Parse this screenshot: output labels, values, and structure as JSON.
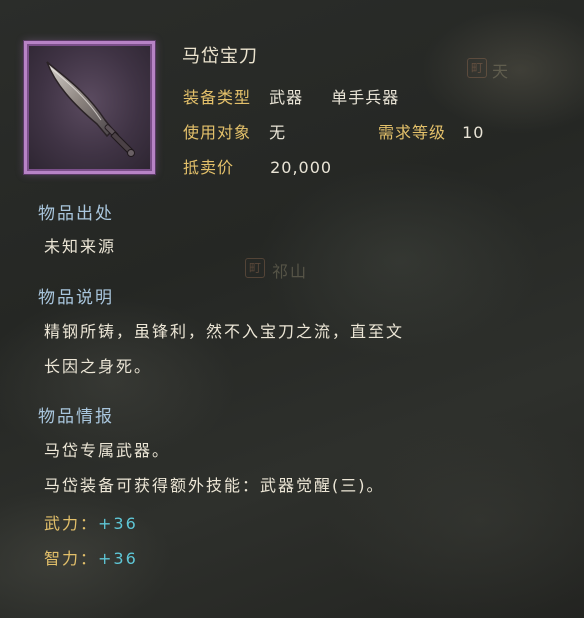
{
  "item": {
    "name": "马岱宝刀",
    "labels": {
      "type": "装备类型",
      "target": "使用对象",
      "req_level": "需求等级",
      "sell_price": "抵卖价"
    },
    "type_value": "武器",
    "subtype_value": "单手兵器",
    "target_value": "无",
    "req_level_value": "10",
    "sell_price_value": "20,000",
    "icon": "saber-icon",
    "frame_color": "#b783c6"
  },
  "sections": {
    "origin": {
      "heading": "物品出处",
      "text": "未知来源"
    },
    "description": {
      "heading": "物品说明",
      "line1": "精钢所铸，虽锋利，然不入宝刀之流，直至文",
      "line2": "长因之身死。"
    },
    "info": {
      "heading": "物品情报",
      "line1": "马岱专属武器。",
      "line2": "马岱装备可获得额外技能：武器觉醒(三)。"
    }
  },
  "stats": [
    {
      "label": "武力：",
      "value": "+36"
    },
    {
      "label": "智力：",
      "value": "+36"
    }
  ],
  "map": {
    "stamp1": "町",
    "label1": "天",
    "stamp2": "町",
    "label2": "祁山"
  },
  "colors": {
    "label": "#e3c06a",
    "heading": "#a9c6dd",
    "stat_value": "#5ec6d6",
    "text": "#ece6d6"
  }
}
